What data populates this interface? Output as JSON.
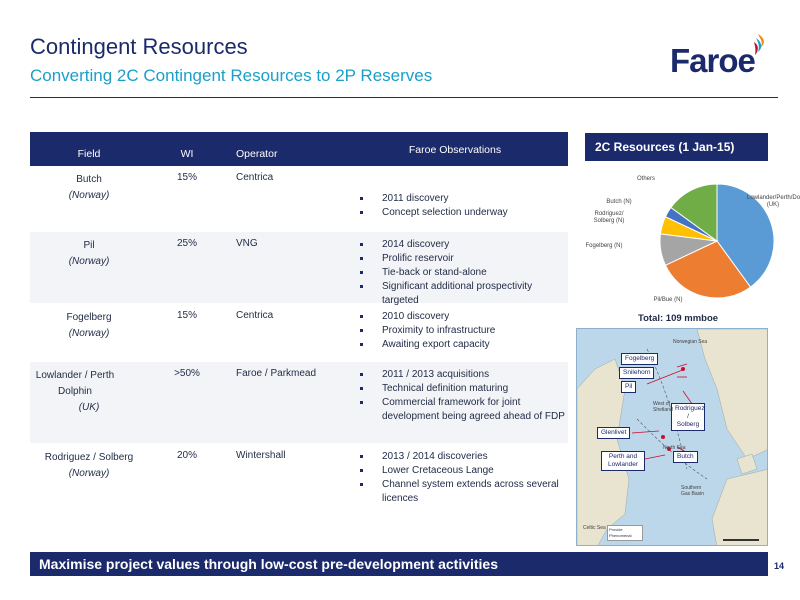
{
  "header": {
    "title": "Contingent Resources",
    "subtitle": "Converting 2C Contingent Resources to 2P Reserves",
    "logo_text": "Faroe"
  },
  "table": {
    "columns": [
      "Field",
      "WI",
      "Operator",
      "Faroe Observations"
    ],
    "rows": [
      {
        "field": "Butch",
        "region": "(Norway)",
        "wi": "15%",
        "operator": "Centrica",
        "observations": [
          "2011 discovery",
          "Concept selection underway"
        ]
      },
      {
        "field": "Pil",
        "region": "(Norway)",
        "wi": "25%",
        "operator": "VNG",
        "observations": [
          "2014 discovery",
          "Prolific reservoir",
          "Tie-back or stand-alone",
          "Significant additional prospectivity targeted"
        ]
      },
      {
        "field": "Fogelberg",
        "region": "(Norway)",
        "wi": "15%",
        "operator": "Centrica",
        "observations": [
          "2010 discovery",
          "Proximity to infrastructure",
          "Awaiting export capacity"
        ]
      },
      {
        "field": "Lowlander / Perth Dolphin",
        "region": "(UK)",
        "wi": ">50%",
        "operator": "Faroe / Parkmead",
        "observations": [
          "2011 / 2013 acquisitions",
          "Technical definition maturing",
          "Commercial framework for joint development being agreed ahead of FDP"
        ]
      },
      {
        "field": "Rodriguez / Solberg",
        "region": "(Norway)",
        "wi": "20%",
        "operator": "Wintershall",
        "observations": [
          "2013 / 2014 discoveries",
          "Lower Cretaceous Lange",
          "Channel system extends across several licences"
        ]
      }
    ]
  },
  "panel": {
    "title": "2C Resources (1 Jan-15)",
    "total": "Total: 109 mmboe"
  },
  "chart_data": {
    "type": "pie",
    "title": "2C Resources (1 Jan-15)",
    "labels": [
      "Lowlander/Perth/Dolphin (UK)",
      "Pil/Bue (N)",
      "Fogelberg (N)",
      "Rodriguez/ Solberg (N)",
      "Butch (N)",
      "Others"
    ],
    "values": [
      40,
      28,
      9,
      5,
      3,
      15
    ],
    "colors": [
      "#5b9bd5",
      "#ed7d31",
      "#a5a5a5",
      "#ffc000",
      "#4472c4",
      "#70ad47"
    ]
  },
  "map": {
    "callouts": [
      "Fogelberg",
      "Snilehorn",
      "Pil",
      "Glenlivet",
      "Perth and Lowlander",
      "Butch",
      "Rodriguez / Solberg"
    ],
    "labels": [
      "Norwegian Sea",
      "West of Shetland",
      "North Sea",
      "Southern Gas Basin",
      "Celtic Sea"
    ],
    "legend": [
      "Provide",
      "Phenomenal"
    ]
  },
  "footer": {
    "banner": "Maximise project values through low-cost pre-development activities",
    "page_number": "14"
  }
}
